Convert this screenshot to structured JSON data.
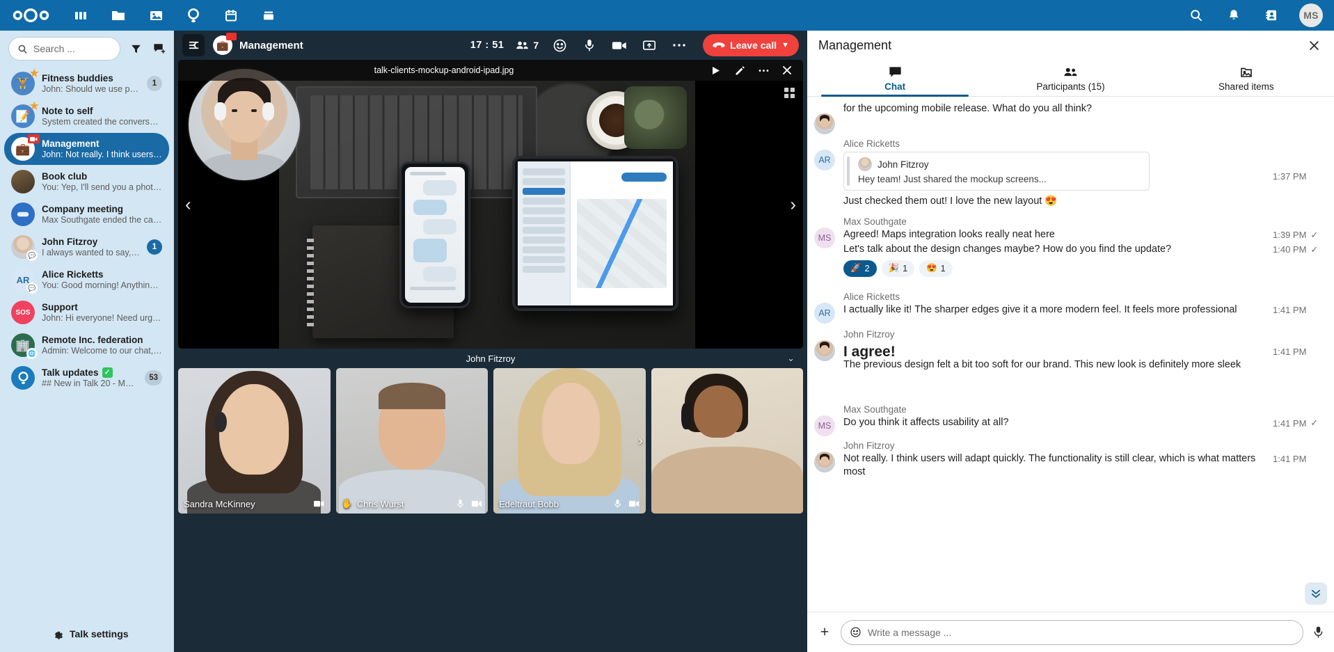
{
  "header": {
    "logo": "nextcloud-logo",
    "apps": [
      {
        "name": "dashboard-icon",
        "glyph": "▥"
      },
      {
        "name": "files-icon",
        "glyph": "📁"
      },
      {
        "name": "photos-icon",
        "glyph": "🖼"
      },
      {
        "name": "talk-icon",
        "glyph": "Q"
      },
      {
        "name": "calendar-icon",
        "glyph": "📅"
      },
      {
        "name": "deck-icon",
        "glyph": "🗄"
      }
    ],
    "search_icon": "search-icon",
    "notifications_icon": "bell-icon",
    "contacts_icon": "contacts-icon",
    "user_initials": "MS"
  },
  "sidebar": {
    "search_placeholder": "Search ...",
    "filter_icon": "filter-icon",
    "new_conversation_icon": "new-conversation-icon",
    "conversations": [
      {
        "name": "Fitness buddies",
        "last": "John: Should we use polls?",
        "badge": "1",
        "badge_style": "grey",
        "avatar_glyph": "🏋",
        "avatar_bg": "#4a86c8",
        "favorite": true,
        "active": false
      },
      {
        "name": "Note to self",
        "last": "System created the conversation",
        "badge": "",
        "avatar_glyph": "📝",
        "avatar_bg": "#4a86c8",
        "favorite": true,
        "active": false
      },
      {
        "name": "Management",
        "last": "John: Not really. I think users wi...",
        "badge": "",
        "avatar_glyph": "💼",
        "avatar_bg": "#ffffff",
        "favorite": false,
        "active": true,
        "recording": true
      },
      {
        "name": "Book club",
        "last": "You: Yep, I'll send you a photo ...",
        "badge": "",
        "avatar_glyph": "",
        "avatar_bg": "#6b4b32",
        "favorite": false,
        "active": false
      },
      {
        "name": "Company meeting",
        "last": "Max Southgate ended the call ...",
        "badge": "",
        "avatar_glyph": "☁",
        "avatar_bg": "#2d6fc4",
        "favorite": false,
        "active": false
      },
      {
        "name": "John Fitzroy",
        "last": "I always wanted to say, ho...",
        "badge": "1",
        "badge_style": "blue",
        "avatar_glyph": "",
        "avatar_bg": "#d7c6b8",
        "favorite": false,
        "active": false,
        "dm": true
      },
      {
        "name": "Alice Ricketts",
        "last": "You: Good morning! Anything ...",
        "badge": "",
        "avatar_glyph": "AR",
        "avatar_bg": "#d7e7f5",
        "avatar_fg": "#2b6fa8",
        "favorite": false,
        "active": false,
        "dm": true
      },
      {
        "name": "Support",
        "last": "John: Hi everyone! Need urgen...",
        "badge": "",
        "avatar_glyph": "SOS",
        "avatar_bg": "#f0425e",
        "avatar_fg": "#ffffff",
        "favorite": false,
        "active": false
      },
      {
        "name": "Remote Inc. federation",
        "last": "Admin: Welcome to our chat, ...",
        "badge": "",
        "avatar_glyph": "🏢",
        "avatar_bg": "#2c6b4f",
        "favorite": false,
        "active": false,
        "federated": true
      },
      {
        "name": "Talk updates",
        "last": "## New in Talk 20 - Mod...",
        "badge": "53",
        "badge_style": "grey",
        "avatar_glyph": "Q",
        "avatar_bg": "#1a7bbd",
        "avatar_fg": "#ffffff",
        "favorite": false,
        "active": false,
        "verified": true
      }
    ],
    "settings_label": "Talk settings",
    "settings_icon": "gear-icon"
  },
  "call": {
    "collapse_icon": "collapse-sidebar-icon",
    "room_avatar_glyph": "💼",
    "room_title": "Management",
    "timer": "17 : 51",
    "participants_icon": "participants-icon",
    "participants_count": "7",
    "reaction_icon": "emoji-icon",
    "mic_icon": "microphone-icon",
    "camera_icon": "camera-icon",
    "screenshare_icon": "screenshare-icon",
    "more_icon": "more-options-icon",
    "leave_label": "Leave call",
    "leave_caret": "▼",
    "phone_icon": "hangup-icon"
  },
  "stage": {
    "file_name": "talk-clients-mockup-android-ipad.jpg",
    "play_icon": "play-icon",
    "edit_icon": "edit-icon",
    "more_icon": "more-options-icon",
    "close_icon": "close-icon",
    "grid_icon": "grid-icon",
    "prev_icon": "previous-arrow-icon",
    "next_icon": "next-arrow-icon",
    "speaker_name": "John Fitzroy",
    "collapse_chevron": "chevron-down-icon"
  },
  "tiles": [
    {
      "name": "Sandra McKinney",
      "mic": "microphone-icon",
      "camera": "camera-icon",
      "hand": false
    },
    {
      "name": "Chris Wurst",
      "mic": "microphone-icon",
      "camera": "camera-icon",
      "hand": true,
      "hand_icon": "raised-hand-icon"
    },
    {
      "name": "Edeltraut Bobb",
      "mic": "microphone-icon",
      "camera": "camera-icon",
      "hand": false
    },
    {
      "name": "",
      "mic": "",
      "camera": "",
      "hand": false
    }
  ],
  "chat": {
    "title": "Management",
    "close_icon": "close-icon",
    "tabs": [
      {
        "label": "Chat",
        "icon": "chat-icon",
        "active": true
      },
      {
        "label": "Participants (15)",
        "icon": "participants-icon",
        "active": false
      },
      {
        "label": "Shared items",
        "icon": "shared-items-icon",
        "active": false
      }
    ],
    "messages": [
      {
        "author": "",
        "avatar": "jf",
        "text": "for the upcoming mobile release. What do you all think?",
        "time": "",
        "read": false
      },
      {
        "author": "Alice Ricketts",
        "avatar": "ar",
        "quote": {
          "name": "John Fitzroy",
          "text": "Hey team! Just shared the mockup screens..."
        },
        "text": "Just checked them out! I love the new layout 😍",
        "time": "1:37 PM",
        "read": false
      },
      {
        "author": "Max Southgate",
        "avatar": "ms",
        "text": "Agreed! Maps integration looks really neat here",
        "time": "1:39 PM",
        "read": true
      },
      {
        "author": "",
        "avatar": "blank",
        "text": "Let's talk about the design changes maybe? How do you find the update?",
        "time": "1:40 PM",
        "read": true,
        "reactions": [
          {
            "emoji": "🚀",
            "count": "2",
            "mine": true
          },
          {
            "emoji": "🎉",
            "count": "1",
            "mine": false
          },
          {
            "emoji": "😍",
            "count": "1",
            "mine": false
          }
        ]
      },
      {
        "author": "Alice Ricketts",
        "avatar": "ar",
        "text": "I actually like it! The sharper edges give it a more modern feel. It feels more professional",
        "time": "1:41 PM",
        "read": false
      },
      {
        "author": "John Fitzroy",
        "avatar": "jf",
        "text": "I agree!",
        "big": true,
        "time": "1:41 PM",
        "read": false
      },
      {
        "author": "",
        "avatar": "blank",
        "text": "The previous design felt a bit too soft for our brand. This new look is definitely more sleek",
        "time": "",
        "read": false
      },
      {
        "author": "Max Southgate",
        "avatar": "ms",
        "text": "Do you think it affects usability at all?",
        "time": "1:41 PM",
        "read": true
      },
      {
        "author": "John Fitzroy",
        "avatar": "jf",
        "text": "Not really. I think users will adapt quickly. The functionality is still clear, which is what matters most",
        "time": "1:41 PM",
        "read": false
      }
    ],
    "scroll_down_icon": "scroll-to-bottom-icon",
    "composer": {
      "add_icon": "add-attachment-icon",
      "emoji_icon": "emoji-icon",
      "placeholder": "Write a message ...",
      "mic_icon": "record-audio-icon"
    }
  },
  "colors": {
    "brand": "#0e6aa8",
    "accent": "#0b5a8e",
    "danger": "#f0413c",
    "sidebar_bg": "#d3e6f3",
    "call_bg": "#1b2b38"
  }
}
